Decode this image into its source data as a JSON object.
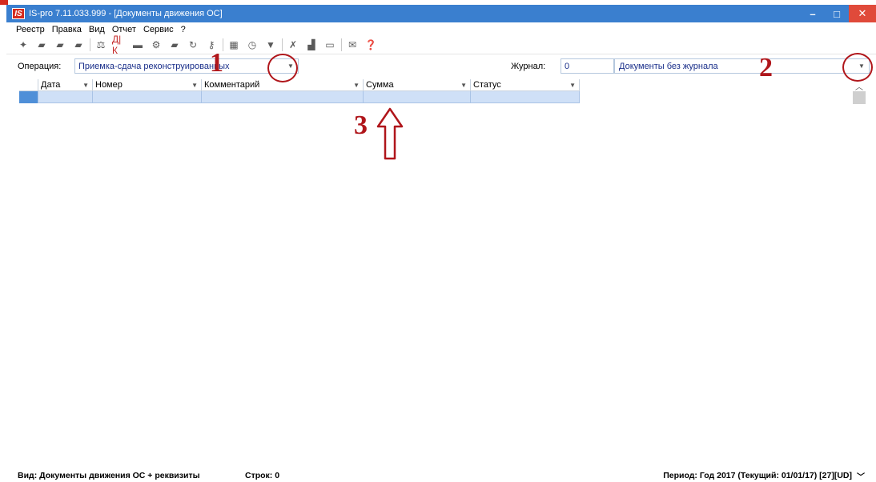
{
  "window": {
    "title": "IS-pro 7.11.033.999 - [Документы движения ОС]",
    "app_icon": "IS",
    "controls": {
      "minimize": "–",
      "maximize": "□",
      "close": "✕"
    }
  },
  "menu": [
    "Реестр",
    "Правка",
    "Вид",
    "Отчет",
    "Сервис",
    "?"
  ],
  "toolbar": {
    "icons": [
      "new-doc-icon",
      "folder-icon",
      "copy-icon",
      "move-icon",
      "scales-icon",
      "dk-icon",
      "print-icon",
      "config-icon",
      "edit-icon",
      "refresh-icon",
      "key-icon",
      "table-icon",
      "clock-icon",
      "filter-icon",
      "filter-clear-icon",
      "chart-icon",
      "calendar-icon",
      "mail-icon",
      "help-icon"
    ],
    "glyphs": [
      "✦",
      "▰",
      "▰",
      "▰",
      "⚖",
      "Д|К",
      "▬",
      "⚙",
      "▰",
      "↻",
      "⚷",
      "▦",
      "◷",
      "▼",
      "✗",
      "▟",
      "▭",
      "✉",
      "❓"
    ]
  },
  "filters": {
    "operation_label": "Операция:",
    "operation_value": "Приемка-сдача реконструированных",
    "journal_label": "Журнал:",
    "journal_number": "0",
    "journal_value": "Документы без журнала"
  },
  "grid": {
    "columns": [
      "Дата",
      "Номер",
      "Комментарий",
      "Сумма",
      "Статус"
    ],
    "rows": [
      [
        "",
        "",
        "",
        "",
        ""
      ]
    ]
  },
  "statusbar": {
    "view": "Вид: Документы движения ОС + реквизиты",
    "rows": "Строк: 0",
    "period": "Период: Год 2017 (Текущий: 01/01/17)  [27][UD]"
  },
  "annotations": {
    "n1": "1",
    "n2": "2",
    "n3": "3"
  },
  "colors": {
    "titlebar": "#3a7fcf",
    "accent": "#b0161b",
    "selection": "#cfe0f7"
  }
}
